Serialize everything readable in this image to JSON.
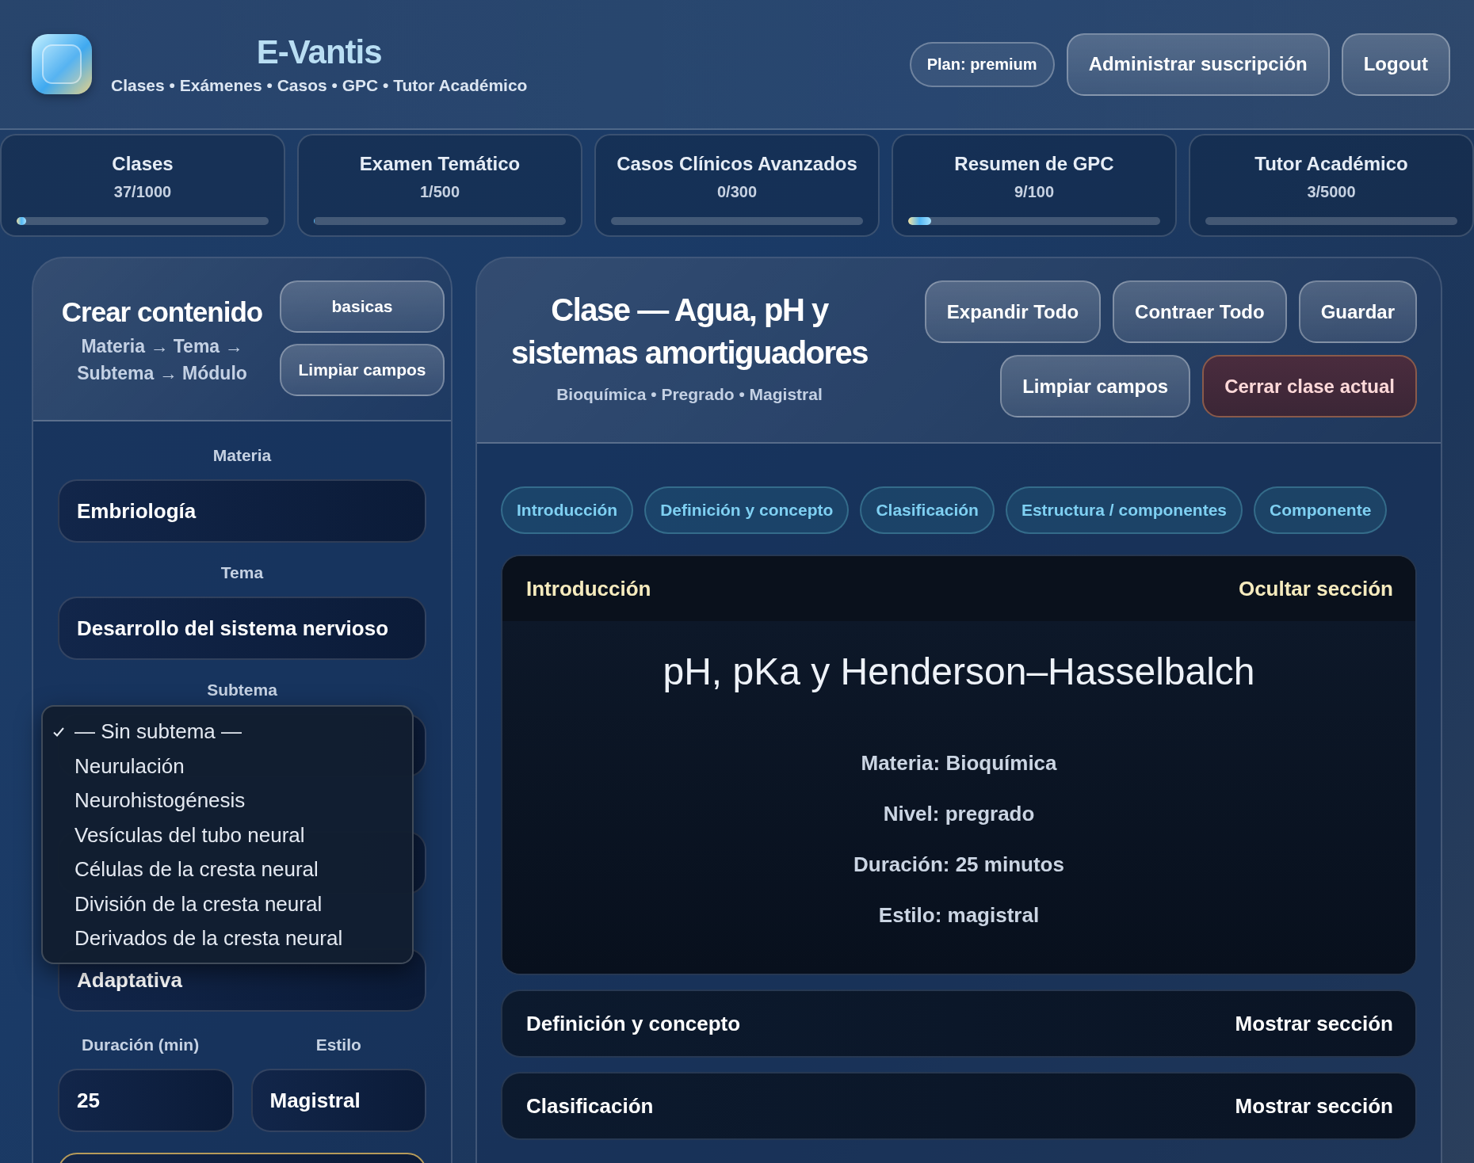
{
  "header": {
    "title": "E-Vantis",
    "subtitle": "Clases • Exámenes • Casos • GPC • Tutor Académico",
    "plan": "Plan: premium",
    "buttons": [
      {
        "label": "Administrar suscripción"
      },
      {
        "label": "Logout"
      }
    ]
  },
  "usage": [
    {
      "name": "Clases",
      "count": "37/1000",
      "level": 0.037
    },
    {
      "name": "Examen Temático",
      "count": "1/500",
      "level": 0.002
    },
    {
      "name": "Casos Clínicos Avanzados",
      "count": "0/300",
      "level": 0
    },
    {
      "name": "Resumen de GPC",
      "count": "9/100",
      "level": 0.09
    },
    {
      "name": "Tutor Académico",
      "count": "3/5000",
      "level": 0.0006
    }
  ],
  "creator": {
    "title": "Crear contenido",
    "subtitle": "Materia → Tema → Subtema → Módulo",
    "buttons": [
      "basicas",
      "Limpiar campos"
    ],
    "fields": [
      {
        "kind": "select",
        "label": "Materia",
        "value": "Embriología"
      },
      {
        "kind": "select",
        "label": "Tema",
        "value": "Desarrollo del sistema nervioso"
      },
      {
        "kind": "select",
        "label": "Subtema"
      },
      {
        "kind": "select"
      },
      {
        "kind": "select",
        "value": "Adaptativa"
      }
    ],
    "pair": [
      {
        "label": "Duración (min)",
        "value": "25"
      },
      {
        "label": "Estilo",
        "value": "Magistral"
      }
    ],
    "dropdown": [
      {
        "label": "— Sin subtema —",
        "selected": true
      },
      {
        "label": "Neurulación",
        "selected": false
      },
      {
        "label": "Neurohistogénesis",
        "selected": false
      },
      {
        "label": "Vesículas del tubo neural",
        "selected": false
      },
      {
        "label": "Células de la cresta neural",
        "selected": false
      },
      {
        "label": "División de la cresta neural",
        "selected": false
      },
      {
        "label": "Derivados de la cresta neural",
        "selected": false
      }
    ]
  },
  "lesson": {
    "title": "Clase — Agua, pH y sistemas amortiguadores",
    "meta": "Bioquímica • Pregrado • Magistral",
    "button_rows": [
      [
        {
          "label": "Expandir Todo",
          "kind": "normal"
        },
        {
          "label": "Contraer Todo",
          "kind": "normal"
        },
        {
          "label": "Guardar",
          "kind": "normal"
        }
      ],
      [
        {
          "label": "Limpiar campos",
          "kind": "normal"
        },
        {
          "label": "Cerrar clase actual",
          "kind": "danger"
        }
      ]
    ],
    "tabs": [
      "Introducción",
      "Definición y concepto",
      "Clasificación",
      "Estructura / componentes",
      "Componente"
    ],
    "sections": [
      {
        "title": "Introducción",
        "toggle": "Ocultar sección",
        "expanded": true,
        "heading": "pH, pKa y Henderson–Hasselbalch",
        "lines": [
          "Materia: Bioquímica",
          "Nivel: pregrado",
          "Duración: 25 minutos",
          "Estilo: magistral"
        ]
      },
      {
        "title": "Definición y concepto",
        "toggle": "Mostrar sección",
        "expanded": false
      },
      {
        "title": "Clasificación",
        "toggle": "Mostrar sección",
        "expanded": false
      }
    ]
  }
}
